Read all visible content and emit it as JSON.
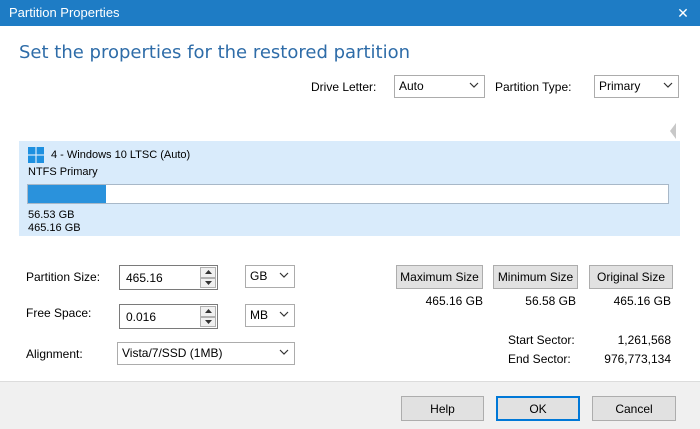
{
  "window": {
    "title": "Partition Properties",
    "close_glyph": "✕"
  },
  "heading": "Set the properties for the restored partition",
  "drive_letter": {
    "label": "Drive Letter:",
    "value": "Auto"
  },
  "partition_type": {
    "label": "Partition Type:",
    "value": "Primary"
  },
  "disk": {
    "name": "4 - Windows 10 LTSC (Auto)",
    "type": "NTFS Primary",
    "used": "56.53 GB",
    "total": "465.16 GB",
    "used_fraction": 0.1215,
    "bar_color": "#2a92dc",
    "panel_color": "#d9ebfb",
    "icon": "windows-logo-icon"
  },
  "partition_size": {
    "label": "Partition Size:",
    "value": "465.16",
    "unit": "GB"
  },
  "free_space": {
    "label": "Free Space:",
    "value": "0.016",
    "unit": "MB"
  },
  "alignment": {
    "label": "Alignment:",
    "value": "Vista/7/SSD (1MB)"
  },
  "size_buttons": {
    "maximum": {
      "label": "Maximum Size",
      "value": "465.16 GB"
    },
    "minimum": {
      "label": "Minimum Size",
      "value": "56.58 GB"
    },
    "original": {
      "label": "Original Size",
      "value": "465.16 GB"
    }
  },
  "sectors": {
    "start_label": "Start Sector:",
    "start_value": "1,261,568",
    "end_label": "End Sector:",
    "end_value": "976,773,134"
  },
  "footer": {
    "help": "Help",
    "ok": "OK",
    "cancel": "Cancel"
  },
  "colors": {
    "titlebar": "#1e7cc5",
    "heading": "#2e6ca8",
    "accent": "#0078d7"
  }
}
